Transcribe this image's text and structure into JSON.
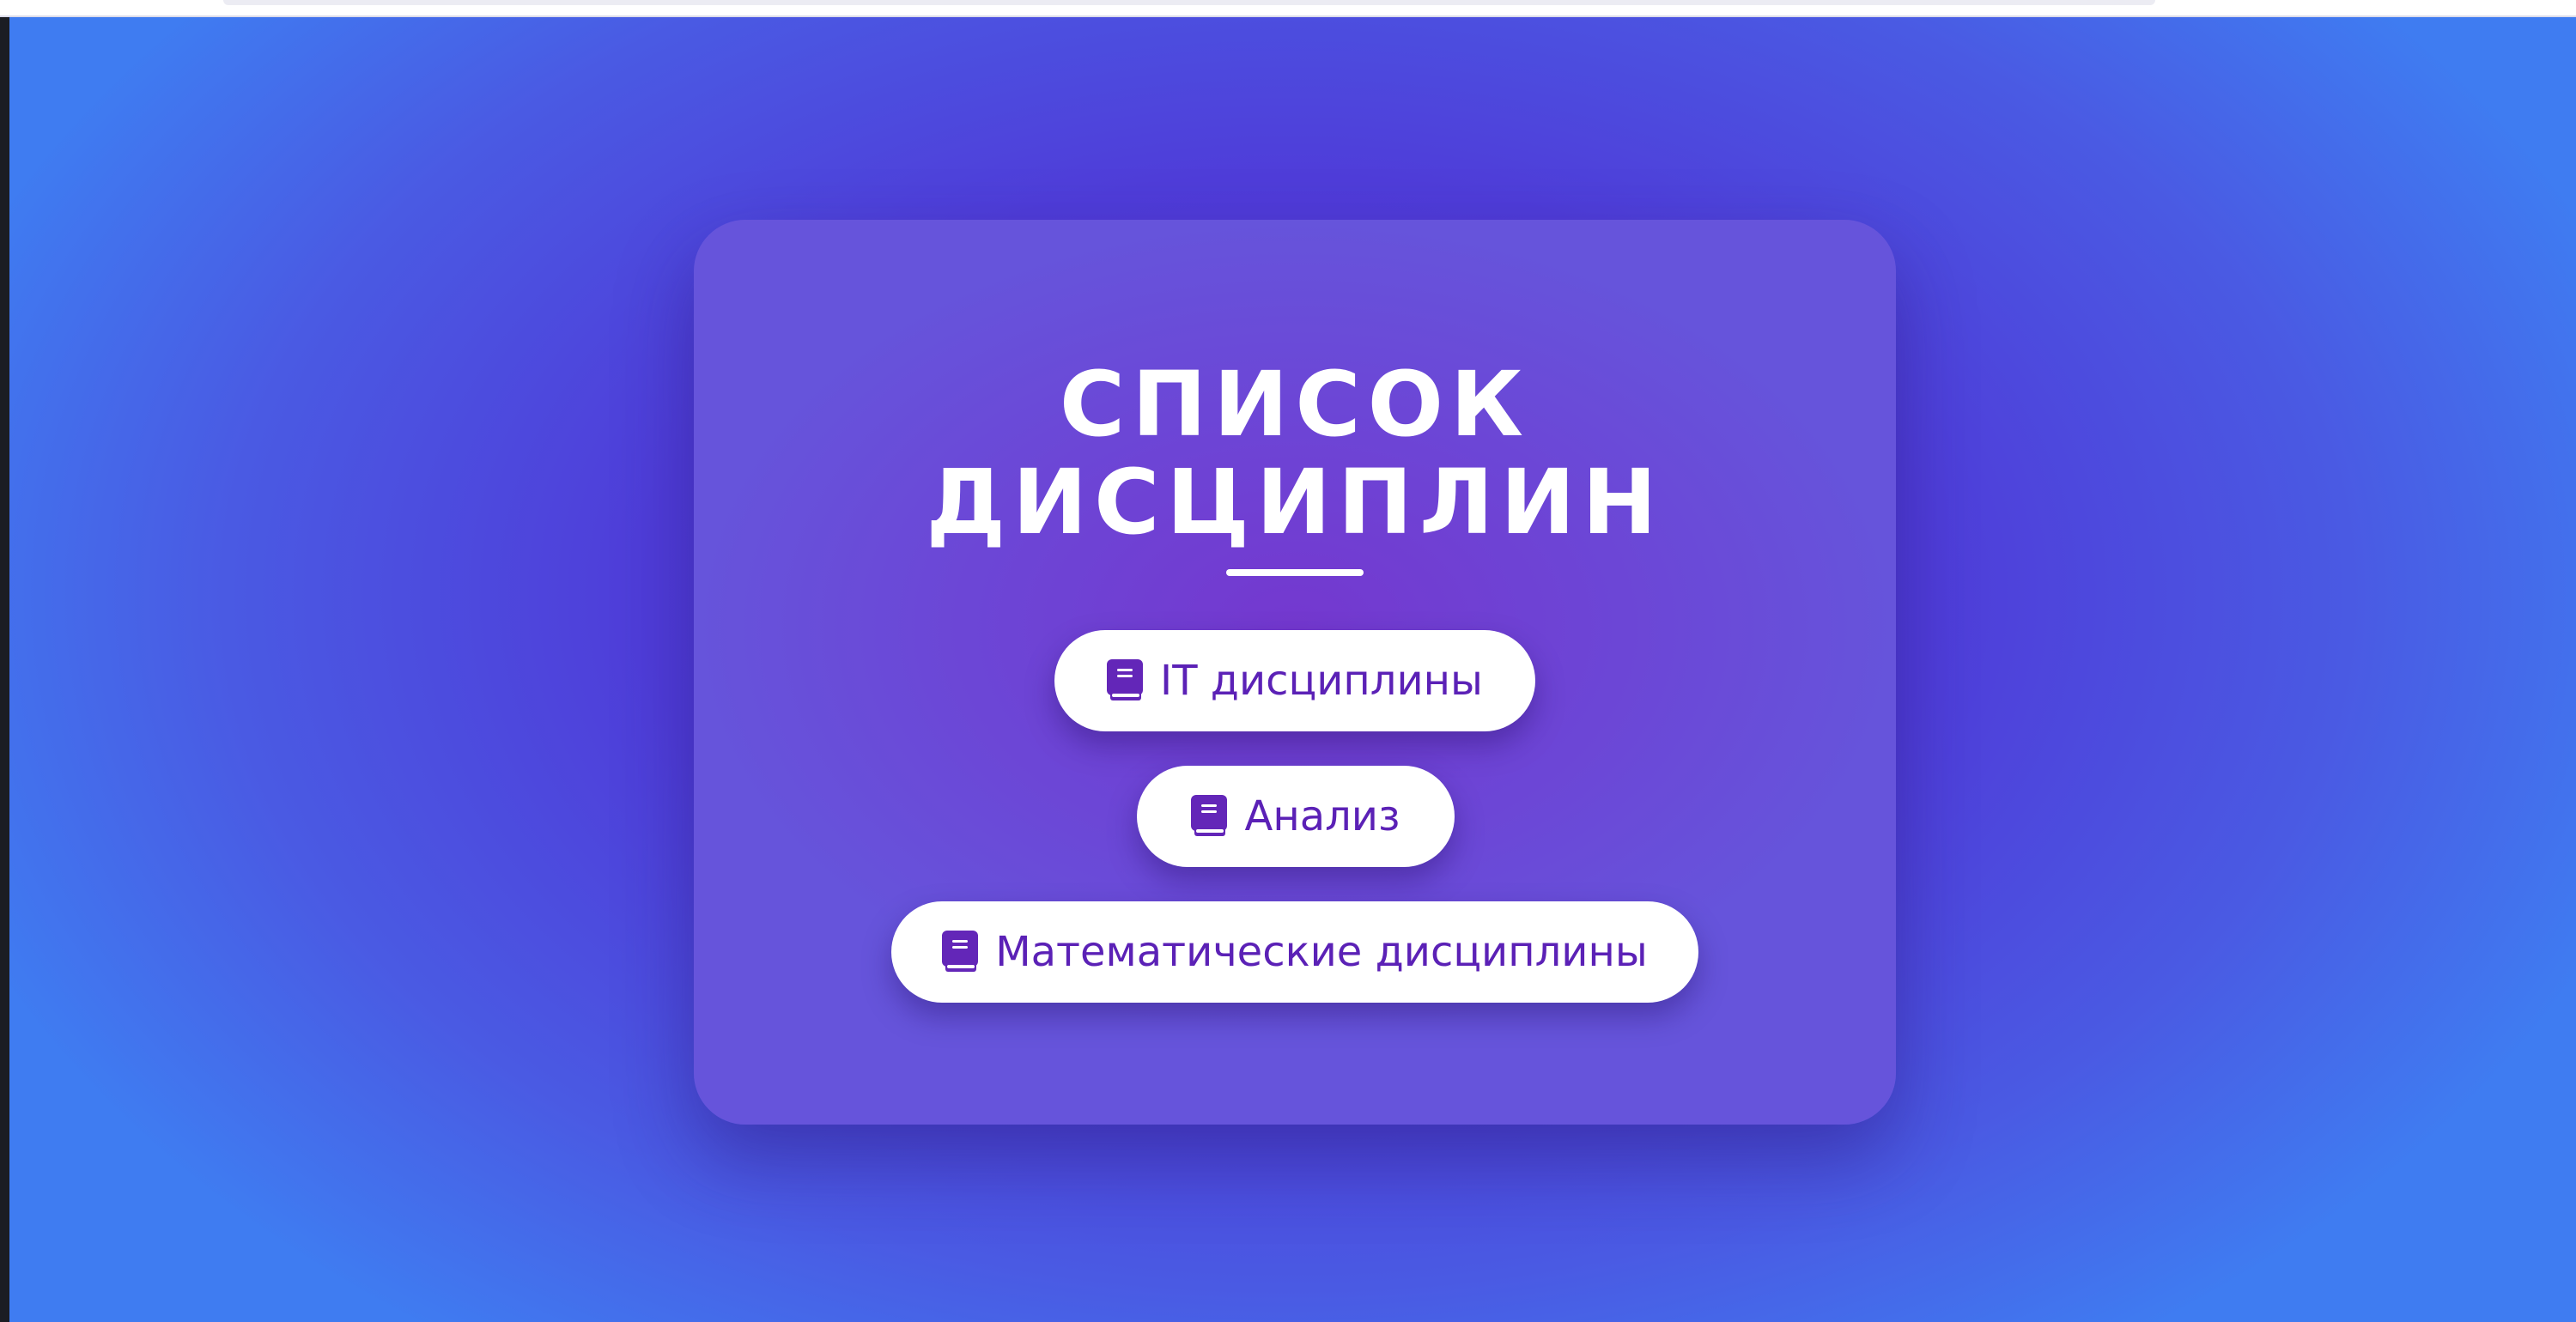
{
  "page": {
    "title_line1": "СПИСОК",
    "title_line2": "ДИСЦИПЛИН"
  },
  "buttons": [
    {
      "label": "IT дисциплины",
      "icon": "book-icon"
    },
    {
      "label": "Анализ",
      "icon": "book-icon"
    },
    {
      "label": "Математические дисциплины",
      "icon": "book-icon"
    }
  ],
  "colors": {
    "background_center": "#5a30d6",
    "background_edge": "#3f7cf1",
    "card": "#6c46d6",
    "button_bg": "#ffffff",
    "button_text": "#5b21b6",
    "title": "#ffffff"
  }
}
